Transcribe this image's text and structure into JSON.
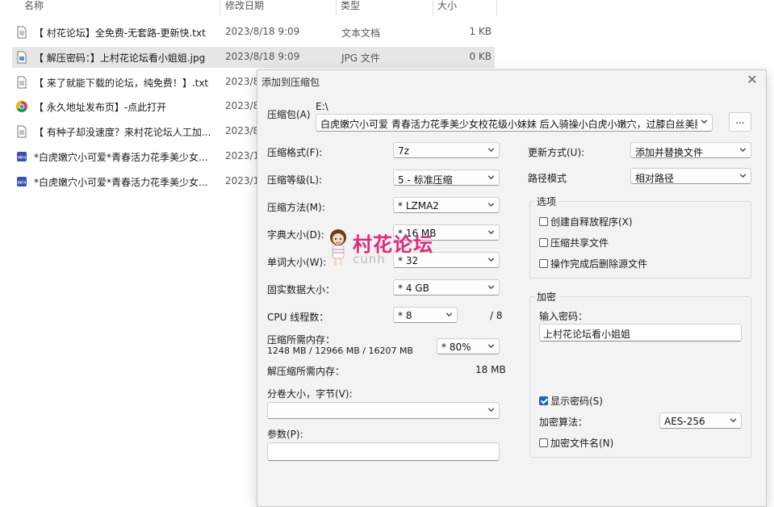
{
  "explorer": {
    "columns": {
      "name": "名称",
      "date": "修改日期",
      "type": "类型",
      "size": "大小"
    },
    "files": [
      {
        "name": "【 村花论坛】全免费-无套路-更新快.txt",
        "date": "2023/8/18 9:09",
        "type": "文本文档",
        "size": "1 KB",
        "icon": "text-file-icon"
      },
      {
        "name": "【 解压密码：】上村花论坛看小姐姐.jpg",
        "date": "2023/8/18 9:09",
        "type": "JPG 文件",
        "size": "0 KB",
        "icon": "image-file-icon"
      },
      {
        "name": "【 来了就能下载的论坛，纯免费！】.txt",
        "date": "2023/8",
        "type": "",
        "size": "",
        "icon": "text-file-icon"
      },
      {
        "name": "【 永久地址发布页】-点此打开",
        "date": "2023/8",
        "type": "",
        "size": "",
        "icon": "chrome-icon"
      },
      {
        "name": "【 有种子却没速度？来村花论坛人工加...",
        "date": "2023/8",
        "type": "",
        "size": "",
        "icon": "text-file-icon"
      },
      {
        "name": "*白虎嫩穴小可爱*青春活力花季美少女...",
        "date": "2023/1",
        "type": "",
        "size": "",
        "icon": "mp4-file-icon"
      },
      {
        "name": "*白虎嫩穴小可爱*青春活力花季美少女...",
        "date": "2023/1",
        "type": "",
        "size": "",
        "icon": "mp4-file-icon"
      }
    ]
  },
  "dialog": {
    "title": "添加到压缩包",
    "archive_label": "压缩包(A)",
    "archive_path": "E:\\",
    "archive_name": "白虎嫩穴小可爱 青春活力花季美少女校花级小妹妹 后入骑操小白虎小嫩穴，过膝白丝美腿",
    "browse_label": "...",
    "left": {
      "format_label": "压缩格式(F):",
      "format_value": "7z",
      "level_label": "压缩等级(L):",
      "level_value": "5 - 标准压缩",
      "method_label": "压缩方法(M):",
      "method_value": "* LZMA2",
      "dict_label": "字典大小(D):",
      "dict_value": "* 16 MB",
      "word_label": "单词大小(W):",
      "word_value": "* 32",
      "solid_label": "固实数据大小：",
      "solid_value": "* 4 GB",
      "threads_label": "CPU 线程数：",
      "threads_value": "* 8",
      "threads_total": "/ 8",
      "mem_label": "压缩所需内存：",
      "mem_value": "1248 MB / 12966 MB / 16207 MB",
      "mem_percent": "* 80%",
      "decomp_label": "解压缩所需内存：",
      "decomp_value": "18 MB",
      "split_label": "分卷大小，字节(V):",
      "split_value": "",
      "params_label": "参数(P):",
      "params_value": ""
    },
    "right": {
      "update_label": "更新方式(U):",
      "update_value": "添加并替换文件",
      "path_label": "路径模式",
      "path_value": "相对路径",
      "options_title": "选项",
      "opt_sfx": "创建自释放程序(X)",
      "opt_shared": "压缩共享文件",
      "opt_delete": "操作完成后删除源文件",
      "enc_title": "加密",
      "enc_pwd_label": "输入密码：",
      "enc_pwd_value": "上村花论坛看小姐姐",
      "show_pwd": "显示密码(S)",
      "enc_method_label": "加密算法：",
      "enc_method_value": "AES-256",
      "enc_names": "加密文件名(N)"
    }
  },
  "watermark": {
    "text": "村花论坛",
    "sub": "cunh"
  },
  "colors": {
    "accent": "#1f5fbf",
    "watermark": "#e02a7a",
    "selected_row": "#e6e6e6"
  }
}
